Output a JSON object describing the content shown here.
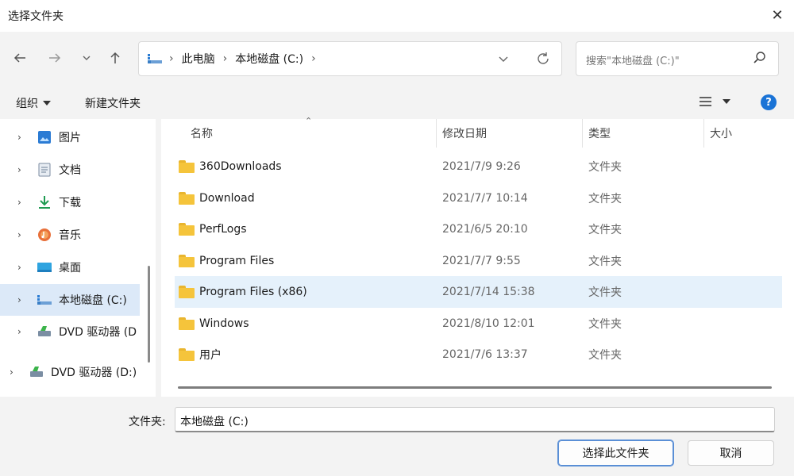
{
  "window": {
    "title": "选择文件夹"
  },
  "address": {
    "crumbs": [
      "此电脑",
      "本地磁盘 (C:)"
    ],
    "search_placeholder": "搜索\"本地磁盘 (C:)\""
  },
  "toolbar": {
    "organize": "组织",
    "new_folder": "新建文件夹"
  },
  "sidebar": {
    "items": [
      {
        "label": "图片",
        "icon": "pictures-icon"
      },
      {
        "label": "文档",
        "icon": "documents-icon"
      },
      {
        "label": "下载",
        "icon": "downloads-icon"
      },
      {
        "label": "音乐",
        "icon": "music-icon"
      },
      {
        "label": "桌面",
        "icon": "desktop-icon"
      },
      {
        "label": "本地磁盘 (C:)",
        "icon": "drive-icon",
        "selected": true
      },
      {
        "label": "DVD 驱动器 (D",
        "icon": "dvd-drive-icon"
      },
      {
        "label": "DVD 驱动器 (D:)",
        "icon": "dvd-drive-icon"
      }
    ]
  },
  "columns": {
    "name": "名称",
    "modified": "修改日期",
    "type": "类型",
    "size": "大小"
  },
  "files": [
    {
      "name": "360Downloads",
      "modified": "2021/7/9 9:26",
      "type": "文件夹"
    },
    {
      "name": "Download",
      "modified": "2021/7/7 10:14",
      "type": "文件夹"
    },
    {
      "name": "PerfLogs",
      "modified": "2021/6/5 20:10",
      "type": "文件夹"
    },
    {
      "name": "Program Files",
      "modified": "2021/7/7 9:55",
      "type": "文件夹"
    },
    {
      "name": "Program Files (x86)",
      "modified": "2021/7/14 15:38",
      "type": "文件夹",
      "selected": true
    },
    {
      "name": "Windows",
      "modified": "2021/8/10 12:01",
      "type": "文件夹"
    },
    {
      "name": "用户",
      "modified": "2021/7/6 13:37",
      "type": "文件夹"
    }
  ],
  "footer": {
    "folder_label": "文件夹:",
    "folder_value": "本地磁盘 (C:)",
    "select_button": "选择此文件夹",
    "cancel_button": "取消"
  },
  "colors": {
    "accent": "#1a73d6",
    "selection": "#e5f1fb",
    "folder": "#f5c43b"
  }
}
